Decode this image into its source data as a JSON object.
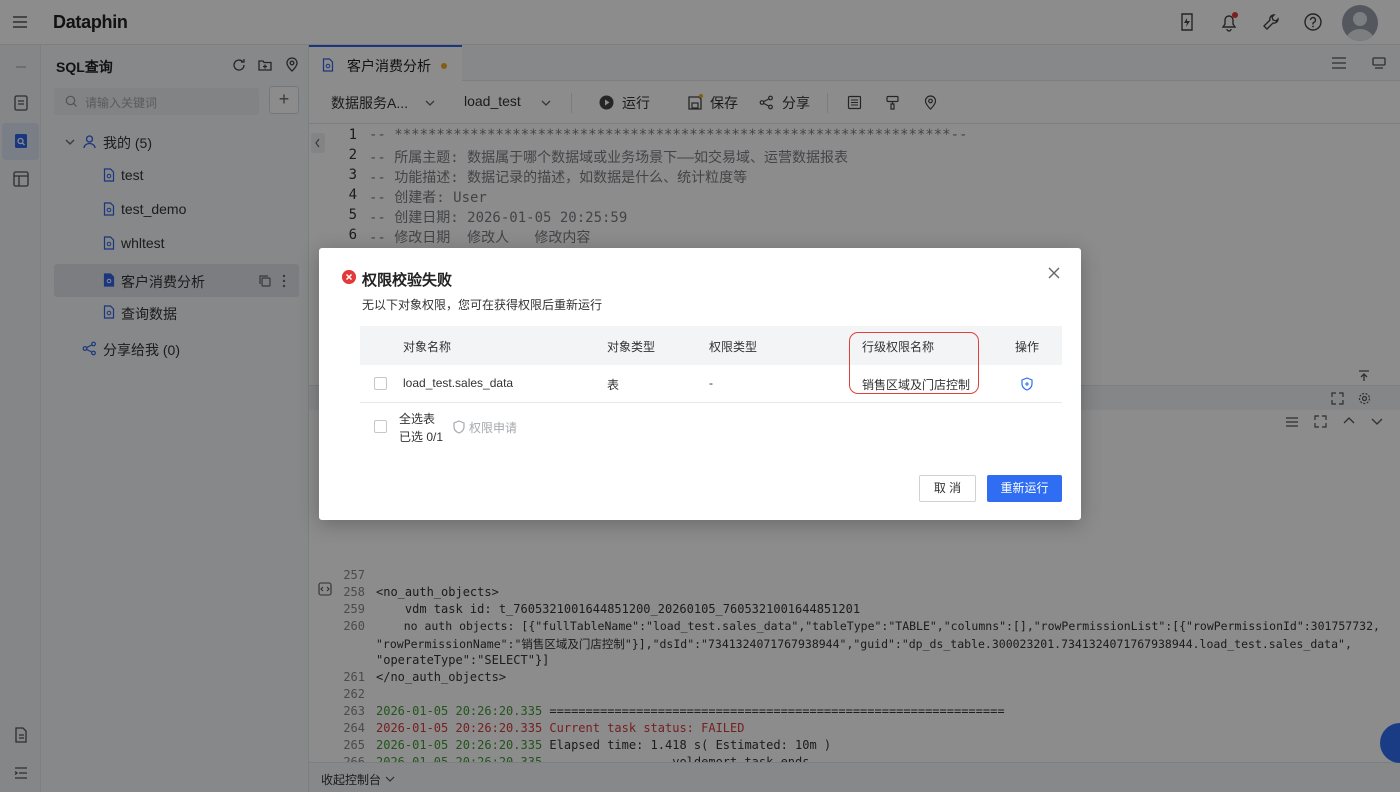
{
  "app": {
    "logo": "Dataphin"
  },
  "sidebar": {
    "title": "SQL查询",
    "search_placeholder": "请输入关键词",
    "my_group": "我的 (5)",
    "items": [
      {
        "label": "test"
      },
      {
        "label": "test_demo"
      },
      {
        "label": "whltest"
      },
      {
        "label": "客户消费分析"
      },
      {
        "label": "查询数据"
      }
    ],
    "shared_group": "分享给我 (0)"
  },
  "editor": {
    "tab_title": "客户消费分析",
    "toolbar": {
      "datasource": "数据服务A...",
      "schema": "load_test",
      "run": "运行",
      "save": "保存",
      "share": "分享"
    },
    "code_lines": [
      {
        "n": "1",
        "text": "-- ******************************************************************--"
      },
      {
        "n": "2",
        "text": "-- 所属主题: 数据属于哪个数据域或业务场景下——如交易域、运营数据报表"
      },
      {
        "n": "3",
        "text": "-- 功能描述: 数据记录的描述，如数据是什么、统计粒度等"
      },
      {
        "n": "4",
        "text": "-- 创建者: User"
      },
      {
        "n": "5",
        "text": "-- 创建日期: 2026-01-05 20:25:59"
      },
      {
        "n": "6",
        "text": "-- 修改日期  修改人   修改内容"
      }
    ],
    "log_lines": [
      {
        "n": "257",
        "text": ""
      },
      {
        "n": "258",
        "text": "<no_auth_objects>"
      },
      {
        "n": "259",
        "text": "    vdm task id: t_7605321001644851200_20260105_7605321001644851201"
      },
      {
        "n": "260",
        "text": "    no auth objects: [{\"fullTableName\":\"load_test.sales_data\",\"tableType\":\"TABLE\",\"columns\":[],\"rowPermissionList\":[{\"rowPermissionId\":301757732,"
      },
      {
        "n": "",
        "text": "\"rowPermissionName\":\"销售区域及门店控制\"}],\"dsId\":\"7341324071767938944\",\"guid\":\"dp_ds_table.300023201.7341324071767938944.load_test.sales_data\","
      },
      {
        "n": "",
        "text": "\"operateType\":\"SELECT\"}]"
      },
      {
        "n": "261",
        "text": "</no_auth_objects>"
      },
      {
        "n": "262",
        "text": ""
      },
      {
        "n": "263",
        "ts": "2026-01-05 20:26:20.335",
        "text": " ==============================================================="
      },
      {
        "n": "264",
        "ts": "2026-01-05 20:26:20.335",
        "text": " Current task status: FAILED",
        "error": true
      },
      {
        "n": "265",
        "ts": "2026-01-05 20:26:20.335",
        "text": " Elapsed time: 1.418 s( Estimated: 10m )"
      },
      {
        "n": "266",
        "ts": "2026-01-05 20:26:20.335",
        "text": " ---------------- voldemort task ends ----------------"
      },
      {
        "n": "267",
        "text": ""
      }
    ],
    "console_toggle": "收起控制台"
  },
  "modal": {
    "title": "权限校验失败",
    "description": "无以下对象权限，您可在获得权限后重新运行",
    "columns": [
      "对象名称",
      "对象类型",
      "权限类型",
      "行级权限名称",
      "操作"
    ],
    "rows": [
      {
        "object_name": "load_test.sales_data",
        "object_type": "表",
        "permission_type": "-",
        "row_permission_name": "销售区域及门店控制"
      }
    ],
    "select_all": "全选表",
    "selected_count": "已选 0/1",
    "apply_permission": "权限申请",
    "cancel": "取 消",
    "rerun": "重新运行"
  },
  "colors": {
    "primary": "#2f6ef2",
    "error": "#e23a3a",
    "highlight_box": "#e0403a",
    "success_log": "#3f9b33"
  }
}
